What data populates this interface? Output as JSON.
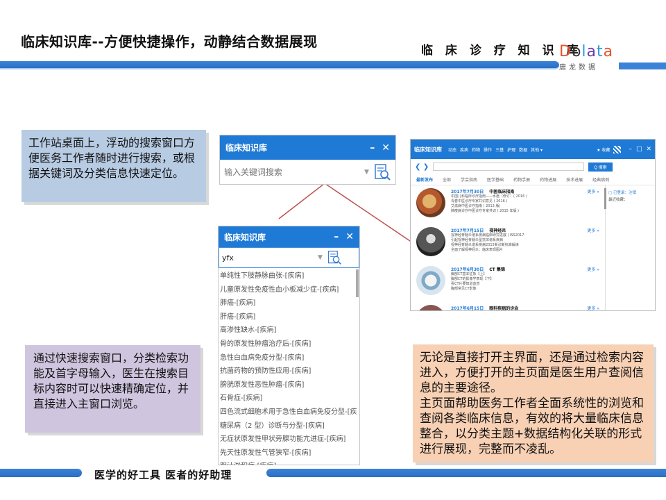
{
  "header": {
    "title": "临床知识库--方便快捷操作，动静结合数据展现",
    "brand": "临 床 诊 疗 知 识 库",
    "logo_word": "Dolata",
    "logo_sub": "唐龙数据"
  },
  "callouts": {
    "desktop": "工作站桌面上，浮动的搜索窗口方便医务工作者随时进行搜索，或根据关键词及分类信息快速定位。",
    "quick_search": "通过快速搜索窗口，分类检索功能及首字母输入，医生在搜索目标内容时可以快速精确定位，并直接进入主窗口浏览。",
    "main_page_1": "无论是直接打开主界面，还是通过检索内容进入，方便打开的主页面是医生用户查阅信息的主要途径。",
    "main_page_2": "主页面帮助医务工作者全面系统性的浏览和查阅各类临床信息，有效的将大量临床信息整合，以分类主题+数据结构化关联的形式进行展现，完整而不凌乱。"
  },
  "widget_small": {
    "title": "临床知识库",
    "minimize": "–",
    "close": "✕",
    "placeholder": "输入关键词搜索"
  },
  "widget_results": {
    "title": "临床知识库",
    "minimize": "–",
    "close": "✕",
    "query": "yfx",
    "results": [
      "单纯性下肢静脉曲张-[疾病]",
      "儿童原发性免疫性血小板减少症-[疾病]",
      "肺癌-[疾病]",
      "肝癌-[疾病]",
      "高渗性缺水-[疾病]",
      "骨的原发性肿瘤治疗后-[疾病]",
      "急性白血病免疫分型-[疾病]",
      "抗菌药物的预防性应用-[疾病]",
      "膀胱原发性恶性肿瘤-[疾病]",
      "石骨症-[疾病]",
      "四色流式细胞术用于急性白血病免疫分型-[疾",
      "糖尿病（2 型）诊断与分型-[疾病]",
      "无症状原发性甲状旁腺功能亢进症-[疾病]",
      "先天性原发性气管狭窄-[疾病]",
      "胆汁淤积症-[疾病]"
    ]
  },
  "main_window": {
    "title": "临床知识库",
    "nav": [
      "动态",
      "疾病",
      "药物",
      "操作",
      "三基",
      "护理",
      "数据",
      "其他 ▾"
    ],
    "favorites": "★ 收藏",
    "minimize": "–",
    "maximize": "□",
    "close": "✕",
    "nav_arrows": "❮ ❯",
    "search_button": "Q 搜索",
    "tabs": [
      "最新发布",
      "全部",
      "学会指南",
      "医学基础",
      "药物手册",
      "药物进展",
      "技术进展",
      "经典病例"
    ],
    "feed": [
      {
        "date": "2017年7月30日",
        "heading": "中医临床指南",
        "more": "更多 »",
        "lines": [
          "中国儿科临床诊疗指南——水痘（修订）( 2016 )",
          "青春中医诊疗专家共识意见 ( 2016 )",
          "艾滋病中医诊疗指南 ( 2013 版)",
          "肺痿病诊疗中医诊疗专家共识 ( 2015 年版 )"
        ]
      },
      {
        "date": "2017年7月15日",
        "heading": "视神经炎",
        "more": "更多 »",
        "lines": [
          "视神经脊髓炎谱系疾病临床研究进展 | ISS2017",
          "引起视神经脊髓炎型抗体谱系疾病",
          "视神经脊髓炎谱系疾病2015新诊断标准解读",
          "全面了解视神经炎：临床表现图片"
        ]
      },
      {
        "date": "2017年6月30日",
        "heading": "CT 集锦",
        "more": "更多 »",
        "lines": [
          "胸部CT基本征象【上】",
          "胸部CT的影像学表现【下】",
          "看CT片要知道血管",
          "胸部常见CT影像"
        ]
      },
      {
        "date": "2017年6月15日",
        "heading": "眼科疾病的诊治",
        "more": "更多 »",
        "lines": []
      }
    ],
    "side_login": "□ 已登录：注销",
    "side_recent": "最近收藏："
  },
  "footer": {
    "text": "医学的好工具  医者的好助理"
  },
  "colors": {
    "accent_blue": "#1f7ad6",
    "callout_blue": "#b7cbe3",
    "callout_purple": "#cfc5df",
    "callout_orange": "#f8d0b4",
    "connector": "#c0504d"
  }
}
